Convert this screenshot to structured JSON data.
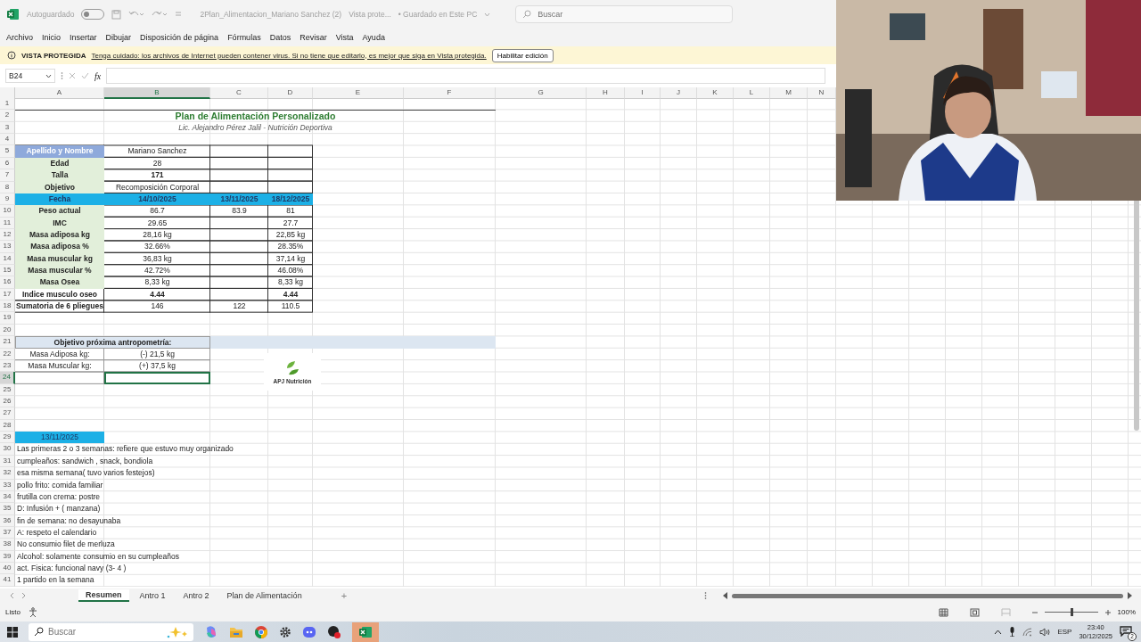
{
  "title_bar": {
    "autosave_label": "Autoguardado",
    "autosave_on": false,
    "filename": "2Plan_Alimentacion_Mariano Sanchez (2)",
    "view_mode": "Vista prote...",
    "save_state": "• Guardado en Este PC",
    "search_placeholder": "Buscar"
  },
  "menu": [
    "Archivo",
    "Inicio",
    "Insertar",
    "Dibujar",
    "Disposición de página",
    "Fórmulas",
    "Datos",
    "Revisar",
    "Vista",
    "Ayuda"
  ],
  "protected_bar": {
    "title": "VISTA PROTEGIDA",
    "message": "Tenga cuidado: los archivos de Internet pueden contener virus. Si no tiene que editarlo, es mejor que siga en Vista protegida.",
    "button": "Habilitar edición"
  },
  "formula_bar": {
    "name_box": "B24",
    "fx": "fx"
  },
  "sheet": {
    "columns": [
      {
        "letter": "A",
        "selected": false
      },
      {
        "letter": "B",
        "selected": true
      },
      {
        "letter": "C",
        "selected": false
      },
      {
        "letter": "D",
        "selected": false
      },
      {
        "letter": "E",
        "selected": false
      },
      {
        "letter": "F",
        "selected": false
      },
      {
        "letter": "G",
        "selected": false
      },
      {
        "letter": "H",
        "selected": false
      },
      {
        "letter": "I",
        "selected": false
      },
      {
        "letter": "J",
        "selected": false
      },
      {
        "letter": "K",
        "selected": false
      },
      {
        "letter": "L",
        "selected": false
      },
      {
        "letter": "M",
        "selected": false
      },
      {
        "letter": "N",
        "selected": false
      }
    ],
    "rows": [
      {
        "number": "1",
        "selected": false,
        "kind": "plain"
      },
      {
        "number": "2",
        "selected": false,
        "kind": "plain",
        "cells": {
          "A": {
            "text": "Plan de Alimentación Personalizado",
            "kind": "title"
          }
        }
      },
      {
        "number": "3",
        "selected": false,
        "kind": "plain",
        "cells": {
          "A": {
            "text": "Lic. Alejandro Pérez Jalil - Nutrición Deportiva",
            "kind": "subtitle"
          }
        }
      },
      {
        "number": "4",
        "selected": false,
        "kind": "plain"
      },
      {
        "number": "5",
        "selected": false,
        "kind": "table",
        "cells": {
          "A": {
            "text": "Apellido y Nombre",
            "kind": "name-head"
          },
          "B": {
            "text": "Mariano Sanchez",
            "kind": "value"
          }
        }
      },
      {
        "number": "6",
        "selected": false,
        "kind": "table",
        "cells": {
          "A": {
            "text": "Edad",
            "kind": "label"
          },
          "B": {
            "text": "28",
            "kind": "value"
          }
        }
      },
      {
        "number": "7",
        "selected": false,
        "kind": "table",
        "cells": {
          "A": {
            "text": "Talla",
            "kind": "label"
          },
          "B": {
            "text": "171",
            "kind": "value-bold"
          }
        }
      },
      {
        "number": "8",
        "selected": false,
        "kind": "table",
        "cells": {
          "A": {
            "text": "Objetivo",
            "kind": "label"
          },
          "B": {
            "text": "Recomposición Corporal",
            "kind": "value"
          }
        }
      },
      {
        "number": "9",
        "selected": false,
        "kind": "table",
        "cells": {
          "A": {
            "text": "Fecha",
            "kind": "date-head"
          },
          "B": {
            "text": "14/10/2025",
            "kind": "date-head"
          },
          "C": {
            "text": "13/11/2025",
            "kind": "date-head"
          },
          "D": {
            "text": "18/12/2025",
            "kind": "date-head"
          }
        }
      },
      {
        "number": "10",
        "selected": false,
        "kind": "table",
        "cells": {
          "A": {
            "text": "Peso actual",
            "kind": "label"
          },
          "B": {
            "text": "86.7",
            "kind": "value"
          },
          "C": {
            "text": "83.9",
            "kind": "value"
          },
          "D": {
            "text": "81",
            "kind": "value"
          }
        }
      },
      {
        "number": "11",
        "selected": false,
        "kind": "table",
        "cells": {
          "A": {
            "text": "IMC",
            "kind": "label"
          },
          "B": {
            "text": "29.65",
            "kind": "value"
          },
          "D": {
            "text": "27.7",
            "kind": "value"
          }
        }
      },
      {
        "number": "12",
        "selected": false,
        "kind": "table",
        "cells": {
          "A": {
            "text": "Masa adiposa kg",
            "kind": "label"
          },
          "B": {
            "text": "28,16 kg",
            "kind": "value"
          },
          "D": {
            "text": "22,85 kg",
            "kind": "value"
          }
        }
      },
      {
        "number": "13",
        "selected": false,
        "kind": "table",
        "cells": {
          "A": {
            "text": "Masa adiposa %",
            "kind": "label"
          },
          "B": {
            "text": "32.66%",
            "kind": "value"
          },
          "D": {
            "text": "28.35%",
            "kind": "value"
          }
        }
      },
      {
        "number": "14",
        "selected": false,
        "kind": "table",
        "cells": {
          "A": {
            "text": "Masa muscular kg",
            "kind": "label"
          },
          "B": {
            "text": "36,83 kg",
            "kind": "value"
          },
          "D": {
            "text": "37,14 kg",
            "kind": "value"
          }
        }
      },
      {
        "number": "15",
        "selected": false,
        "kind": "table",
        "cells": {
          "A": {
            "text": "Masa muscular %",
            "kind": "label"
          },
          "B": {
            "text": "42.72%",
            "kind": "value"
          },
          "D": {
            "text": "46.08%",
            "kind": "value"
          }
        }
      },
      {
        "number": "16",
        "selected": false,
        "kind": "table",
        "cells": {
          "A": {
            "text": "Masa Osea",
            "kind": "label"
          },
          "B": {
            "text": "8,33 kg",
            "kind": "value"
          },
          "D": {
            "text": "8,33 kg",
            "kind": "value"
          }
        }
      },
      {
        "number": "17",
        "selected": false,
        "kind": "table",
        "cells": {
          "A": {
            "text": "Indice musculo oseo",
            "kind": "label-plain"
          },
          "B": {
            "text": "4.44",
            "kind": "value-bold"
          },
          "D": {
            "text": "4.44",
            "kind": "value-bold"
          }
        }
      },
      {
        "number": "18",
        "selected": false,
        "kind": "table",
        "cells": {
          "A": {
            "text": "Sumatoria de 6 pliegues",
            "kind": "label-plain"
          },
          "B": {
            "text": "146",
            "kind": "value"
          },
          "C": {
            "text": "122",
            "kind": "value"
          },
          "D": {
            "text": "110.5",
            "kind": "value"
          }
        }
      },
      {
        "number": "19",
        "selected": false,
        "kind": "plain"
      },
      {
        "number": "20",
        "selected": false,
        "kind": "plain"
      },
      {
        "number": "21",
        "selected": false,
        "kind": "band",
        "cells": {
          "A": {
            "text": "Objetivo próxima antropometría:",
            "kind": "target-head"
          }
        }
      },
      {
        "number": "22",
        "selected": false,
        "kind": "target",
        "cells": {
          "A": {
            "text": "Masa Adiposa kg:",
            "kind": "value"
          },
          "B": {
            "text": "(-) 21,5 kg",
            "kind": "value"
          }
        }
      },
      {
        "number": "23",
        "selected": false,
        "kind": "target",
        "cells": {
          "A": {
            "text": "Masa Muscular kg:",
            "kind": "value"
          },
          "B": {
            "text": "(+) 37,5  kg",
            "kind": "value"
          }
        }
      },
      {
        "number": "24",
        "selected": true,
        "kind": "target"
      },
      {
        "number": "25",
        "selected": false,
        "kind": "plain"
      },
      {
        "number": "26",
        "selected": false,
        "kind": "plain"
      },
      {
        "number": "27",
        "selected": false,
        "kind": "plain"
      },
      {
        "number": "28",
        "selected": false,
        "kind": "plain"
      },
      {
        "number": "29",
        "selected": false,
        "kind": "plain",
        "cells": {
          "A": {
            "text": "13/11/2025",
            "kind": "date-tag"
          }
        }
      },
      {
        "number": "30",
        "selected": false,
        "kind": "plain",
        "cells": {
          "A": {
            "text": "Las primeras 2 o 3 semanas: refiere que estuvo muy organizado",
            "kind": "note"
          }
        }
      },
      {
        "number": "31",
        "selected": false,
        "kind": "plain",
        "cells": {
          "A": {
            "text": "cumpleaños: sandwich , snack, bondiola",
            "kind": "note"
          }
        }
      },
      {
        "number": "32",
        "selected": false,
        "kind": "plain",
        "cells": {
          "A": {
            "text": "esa misma semana( tuvo varios festejos)",
            "kind": "note"
          }
        }
      },
      {
        "number": "33",
        "selected": false,
        "kind": "plain",
        "cells": {
          "A": {
            "text": "pollo frito: comida familiar",
            "kind": "note"
          }
        }
      },
      {
        "number": "34",
        "selected": false,
        "kind": "plain",
        "cells": {
          "A": {
            "text": "frutilla con crema: postre",
            "kind": "note"
          }
        }
      },
      {
        "number": "35",
        "selected": false,
        "kind": "plain",
        "cells": {
          "A": {
            "text": "D: Infusión + ( manzana)",
            "kind": "note"
          }
        }
      },
      {
        "number": "36",
        "selected": false,
        "kind": "plain",
        "cells": {
          "A": {
            "text": "fin de semana: no desayunaba",
            "kind": "note"
          }
        }
      },
      {
        "number": "37",
        "selected": false,
        "kind": "plain",
        "cells": {
          "A": {
            "text": "A: respeto el calendario",
            "kind": "note"
          }
        }
      },
      {
        "number": "38",
        "selected": false,
        "kind": "plain",
        "cells": {
          "A": {
            "text": "No consumio filet de merluza",
            "kind": "note"
          }
        }
      },
      {
        "number": "39",
        "selected": false,
        "kind": "plain",
        "cells": {
          "A": {
            "text": "Alcohol: solamente consumio en su cumpleaños",
            "kind": "note"
          }
        }
      },
      {
        "number": "40",
        "selected": false,
        "kind": "plain",
        "cells": {
          "A": {
            "text": "act. Fisica: funcional navy (3- 4 )",
            "kind": "note"
          }
        }
      },
      {
        "number": "41",
        "selected": false,
        "kind": "plain",
        "cells": {
          "A": {
            "text": "1 partido en la semana",
            "kind": "note"
          }
        }
      }
    ],
    "logo": {
      "text": "APJ Nutrición"
    }
  },
  "sheet_tabs": [
    {
      "label": "Resumen",
      "selected": true
    },
    {
      "label": "Antro 1",
      "selected": false
    },
    {
      "label": "Antro 2",
      "selected": false
    },
    {
      "label": "Plan de Alimentación",
      "selected": false
    }
  ],
  "add_sheet": "+",
  "status_bar": {
    "status": "Listo",
    "zoom_level": {
      "level": 0.5
    },
    "zoom": "100%"
  },
  "taskbar": {
    "search_placeholder": "Buscar",
    "language": "ESP",
    "time": "23:40",
    "date": "30/12/2025",
    "notifications": "2"
  }
}
